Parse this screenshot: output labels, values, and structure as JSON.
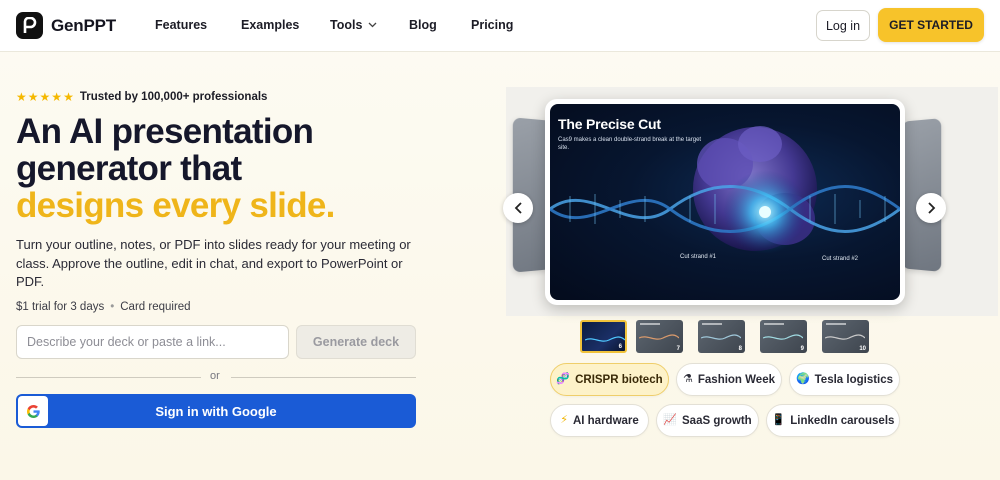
{
  "brand": {
    "name": "GenPPT"
  },
  "nav": {
    "links": [
      "Features",
      "Examples",
      "Tools",
      "Blog",
      "Pricing"
    ],
    "login": "Log in",
    "cta": "GET STARTED"
  },
  "hero": {
    "trust": "Trusted by 100,000+ professionals",
    "stars": 5,
    "headline_1": "An AI presentation",
    "headline_2": "generator that",
    "headline_3": "designs every slide.",
    "subtext": "Turn your outline, notes, or PDF into slides ready for your meeting or class. Approve the outline, edit in chat, and export to PowerPoint or PDF.",
    "trial": "$1 trial for 3 days",
    "card_note": "Card required",
    "input_placeholder": "Describe your deck or paste a link...",
    "generate_label": "Generate deck",
    "or_label": "or",
    "google_label": "Sign in with Google"
  },
  "slide": {
    "title": "The Precise Cut",
    "subtitle": "Cas9 makes a clean double-strand break at the target site.",
    "label_1": "Cut strand #1",
    "label_2": "Cut strand #2"
  },
  "thumbnails": [
    {
      "num": "6",
      "active": true
    },
    {
      "num": "7",
      "active": false
    },
    {
      "num": "8",
      "active": false
    },
    {
      "num": "9",
      "active": false
    },
    {
      "num": "10",
      "active": false
    }
  ],
  "chips": [
    {
      "label": "CRISPR biotech",
      "icon": "dna-icon",
      "active": true
    },
    {
      "label": "Fashion Week",
      "icon": "flask-icon",
      "active": false
    },
    {
      "label": "Tesla logistics",
      "icon": "globe-icon",
      "active": false
    },
    {
      "label": "AI hardware",
      "icon": "lightning-icon",
      "active": false
    },
    {
      "label": "SaaS growth",
      "icon": "chart-icon",
      "active": false
    },
    {
      "label": "LinkedIn carousels",
      "icon": "phone-icon",
      "active": false
    }
  ],
  "colors": {
    "accent": "#f7c32a",
    "headline_highlight": "#efb51a",
    "google_blue": "#1a5bd6"
  }
}
